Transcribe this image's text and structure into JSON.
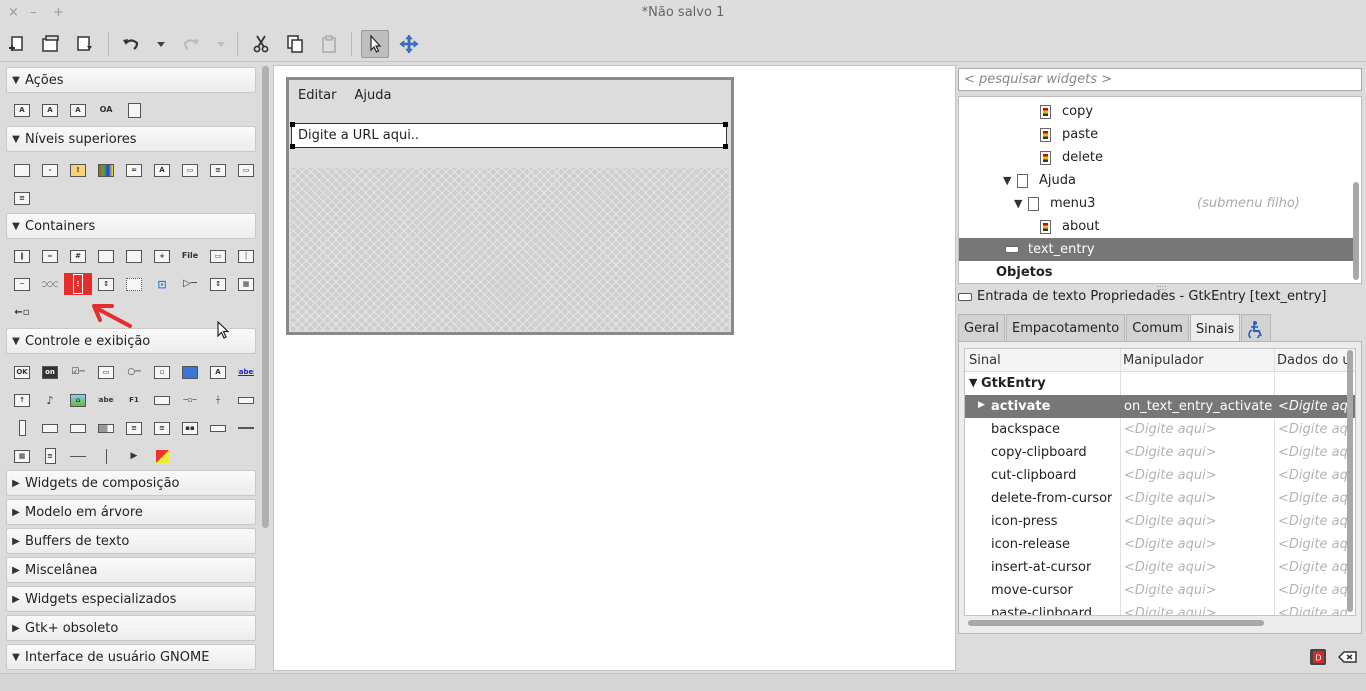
{
  "window": {
    "title": "*Não salvo 1",
    "controls": {
      "close": "×",
      "minimize": "–",
      "maximize": "+"
    }
  },
  "toolbar": {
    "tools": [
      "new-document-icon",
      "open-document-icon",
      "save-document-icon",
      "undo-icon",
      "redo-icon",
      "cut-icon",
      "copy-icon",
      "paste-icon",
      "pointer-icon",
      "drag-resize-icon"
    ],
    "dropdown": "▾"
  },
  "palette": {
    "sections": [
      {
        "label": "Ações",
        "arrow": "▼"
      },
      {
        "label": "Níveis superiores",
        "arrow": "▼"
      },
      {
        "label": "Containers",
        "arrow": "▼"
      },
      {
        "label": "Controle e exibição",
        "arrow": "▼"
      },
      {
        "label": "Widgets de composição",
        "arrow": "▶"
      },
      {
        "label": "Modelo em árvore",
        "arrow": "▶"
      },
      {
        "label": "Buffers de texto",
        "arrow": "▶"
      },
      {
        "label": "Miscelânea",
        "arrow": "▶"
      },
      {
        "label": "Widgets especializados",
        "arrow": "▶"
      },
      {
        "label": "Gtk+ obsoleto",
        "arrow": "▶"
      },
      {
        "label": "Interface de usuário GNOME",
        "arrow": "▼"
      }
    ],
    "glyphs": {
      "file": "File",
      "ok": "OK",
      "on": "on",
      "label": "label",
      "f1": "F1",
      "oa": "OA",
      "dots": "○○○"
    },
    "selected_icon": "vertical-paned-icon"
  },
  "design": {
    "menu": [
      "Editar",
      "Ajuda"
    ],
    "entry_text": "Digite a URL aqui.."
  },
  "inspector": {
    "search_placeholder": "< pesquisar widgets >",
    "tree": [
      {
        "label": "copy"
      },
      {
        "label": "paste"
      },
      {
        "label": "delete"
      },
      {
        "label": "Ajuda",
        "toggle": "▼"
      },
      {
        "label": "menu3",
        "toggle": "▼",
        "hint": "(submenu filho)"
      },
      {
        "label": "about"
      },
      {
        "label": "text_entry",
        "selected": true
      },
      {
        "label": "Objetos"
      }
    ],
    "grip": "::::"
  },
  "properties": {
    "title": "Entrada de texto Propriedades - GtkEntry [text_entry]",
    "tabs": [
      "Geral",
      "Empacotamento",
      "Comum",
      "Sinais"
    ],
    "active_tab": "Sinais",
    "accessibility_icon": "accessibility-icon",
    "columns": [
      "Sinal",
      "Manipulador",
      "Dados do u"
    ],
    "group": {
      "label": "GtkEntry",
      "toggle": "▼"
    },
    "placeholder": "<Digite aqui>",
    "data_placeholder": "<Digite aq",
    "signals": [
      {
        "name": "activate",
        "handler": "on_text_entry_activate",
        "toggle": "▶"
      },
      {
        "name": "backspace"
      },
      {
        "name": "copy-clipboard"
      },
      {
        "name": "cut-clipboard"
      },
      {
        "name": "delete-from-cursor"
      },
      {
        "name": "icon-press"
      },
      {
        "name": "icon-release"
      },
      {
        "name": "insert-at-cursor"
      },
      {
        "name": "move-cursor"
      },
      {
        "name": "paste-clipboard"
      }
    ]
  },
  "colors": {
    "selection": "#777777",
    "annotation": "#e42e2e",
    "accent": "#3a76d8"
  }
}
